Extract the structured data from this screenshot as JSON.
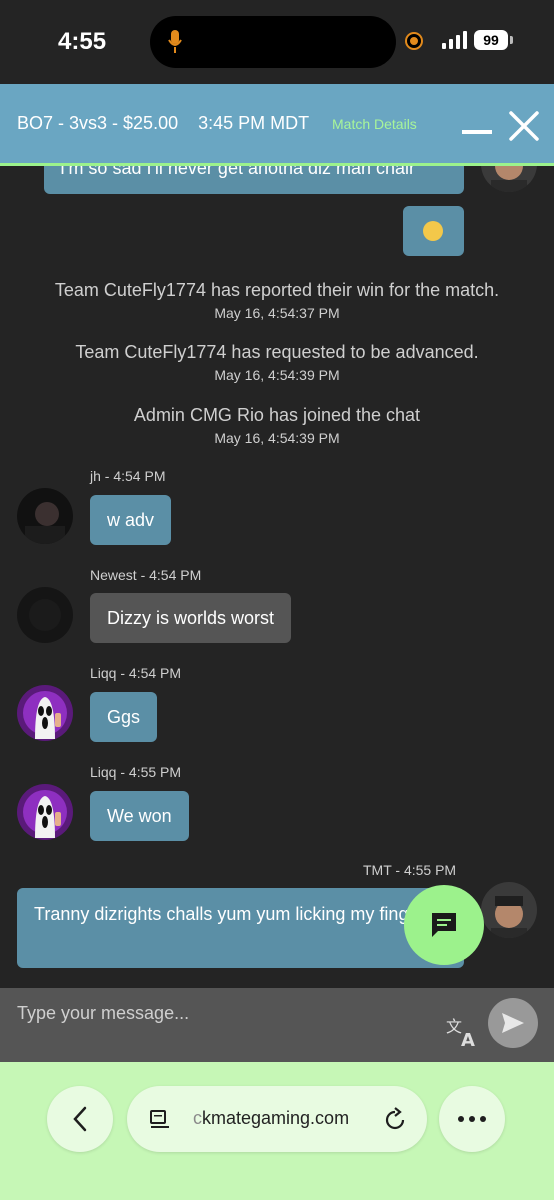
{
  "status_bar": {
    "time": "4:55",
    "battery": "99"
  },
  "header": {
    "title": "BO7 - 3vs3 - $25.00    3:45 PM MDT",
    "match_details": "Match Details"
  },
  "partial_message": {
    "text": "I'm so sad I'll never get anotha diz man chair"
  },
  "system_messages": [
    {
      "text": "Team CuteFly1774 has reported their win for the match.",
      "time": "May 16, 4:54:37 PM"
    },
    {
      "text": "Team CuteFly1774 has requested to be advanced.",
      "time": "May 16, 4:54:39 PM"
    },
    {
      "text": "Admin CMG Rio has joined the chat",
      "time": "May 16, 4:54:39 PM"
    }
  ],
  "messages": [
    {
      "sender": "jh - 4:54 PM",
      "text": "w adv"
    },
    {
      "sender": "Newest - 4:54 PM",
      "text": "Dizzy is worlds worst"
    },
    {
      "sender": "Liqq - 4:54 PM",
      "text": "Ggs"
    },
    {
      "sender": "Liqq - 4:55 PM",
      "text": "We won"
    },
    {
      "sender": "TMT - 4:55 PM",
      "text": "Tranny dizrights challs yum yum licking my fingers"
    }
  ],
  "input": {
    "placeholder": "Type your message..."
  },
  "browser": {
    "url_faded": "c",
    "url_main": "kmategaming.com"
  },
  "colors": {
    "header": "#6aa6c2",
    "accent_green": "#9cf28c",
    "bubble_blue": "#5b8fa6",
    "bubble_grey": "#555555",
    "background": "#242424"
  }
}
